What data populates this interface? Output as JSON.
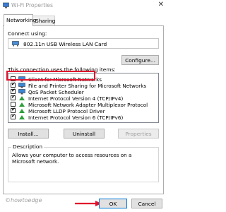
{
  "window": {
    "title": "Wi-Fi Properties",
    "close_glyph": "✕"
  },
  "tabs": [
    {
      "label": "Networking"
    },
    {
      "label": "Sharing"
    }
  ],
  "connect": {
    "label": "Connect using:",
    "adapter": "802.11n USB Wireless LAN Card",
    "configure_label": "Configure..."
  },
  "items_section": {
    "label": "This connection uses the following items:",
    "items": [
      {
        "label": "Client for Microsoft Networks",
        "checked": false,
        "icon": "network-client-icon"
      },
      {
        "label": "File and Printer Sharing for Microsoft Networks",
        "checked": true,
        "icon": "network-client-icon"
      },
      {
        "label": "QoS Packet Scheduler",
        "checked": true,
        "icon": "network-client-icon"
      },
      {
        "label": "Internet Protocol Version 4 (TCP/IPv4)",
        "checked": true,
        "icon": "protocol-icon"
      },
      {
        "label": "Microsoft Network Adapter Multiplexor Protocol",
        "checked": false,
        "icon": "protocol-icon"
      },
      {
        "label": "Microsoft LLDP Protocol Driver",
        "checked": true,
        "icon": "protocol-icon"
      },
      {
        "label": "Internet Protocol Version 6 (TCP/IPv6)",
        "checked": true,
        "icon": "protocol-icon"
      }
    ]
  },
  "item_buttons": {
    "install": "Install...",
    "uninstall": "Uninstall",
    "properties": "Properties"
  },
  "description": {
    "title": "Description",
    "text": "Allows your computer to access resources on a Microsoft network."
  },
  "watermark": "©howtoedge",
  "footer": {
    "ok": "OK",
    "cancel": "Cancel"
  },
  "colors": {
    "highlight": "#e0142c",
    "protocol_green": "#2e9e3a",
    "accent_blue": "#0078d7"
  }
}
